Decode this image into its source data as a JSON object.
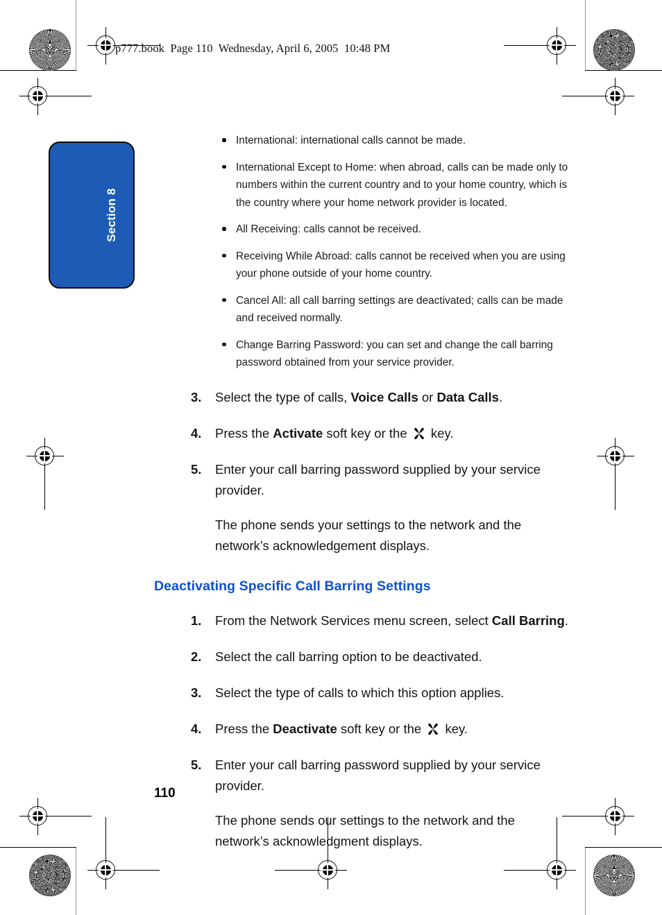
{
  "header": {
    "text": "p777.book  Page 110  Wednesday, April 6, 2005  10:48 PM"
  },
  "section_tab": {
    "label": "Section 8",
    "fill_color": "#1d5bb5",
    "border_color": "#0b0b0b",
    "text_color": "#ffffff"
  },
  "colors": {
    "heading_blue": "#0a50d6",
    "body_text": "#141414"
  },
  "bullets": [
    {
      "text": "International: international calls cannot be made."
    },
    {
      "text": "International Except to Home: when abroad, calls can be made only to numbers within the current country and to your home country, which is the country where your home network provider is located."
    },
    {
      "text": "All Receiving: calls cannot be received."
    },
    {
      "text": "Receiving While Abroad: calls cannot be received when you are using your phone outside of your home country."
    },
    {
      "text": "Cancel All: all call barring settings are deactivated; calls can be made and received normally."
    },
    {
      "text": "Change Barring Password: you can set and change the call barring password obtained from your service provider."
    }
  ],
  "steps_first": [
    {
      "num": "3.",
      "parts": [
        {
          "t": "Select the type of calls, ",
          "b": false
        },
        {
          "t": "Voice Calls",
          "b": true
        },
        {
          "t": " or ",
          "b": false
        },
        {
          "t": "Data Calls",
          "b": true
        },
        {
          "t": ".",
          "b": false
        }
      ]
    },
    {
      "num": "4.",
      "parts": [
        {
          "t": "Press the ",
          "b": false
        },
        {
          "t": "Activate",
          "b": true
        },
        {
          "t": " soft key or the ",
          "b": false
        },
        {
          "icon": "ok-key-icon"
        },
        {
          "t": " key.",
          "b": false
        }
      ]
    },
    {
      "num": "5.",
      "parts": [
        {
          "t": "Enter your call barring password supplied by your service provider.",
          "b": false
        }
      ]
    }
  ],
  "paragraph_first": "The phone sends your settings to the network and the network’s acknowledgement displays.",
  "sub_heading": "Deactivating Specific Call Barring Settings",
  "steps_second": [
    {
      "num": "1.",
      "parts": [
        {
          "t": "From the Network Services menu screen, select ",
          "b": false
        },
        {
          "t": "Call Barring",
          "b": true
        },
        {
          "t": ".",
          "b": false
        }
      ]
    },
    {
      "num": "2.",
      "parts": [
        {
          "t": "Select the call barring option to be deactivated.",
          "b": false
        }
      ]
    },
    {
      "num": "3.",
      "parts": [
        {
          "t": "Select the type of calls to which this option applies.",
          "b": false
        }
      ]
    },
    {
      "num": "4.",
      "parts": [
        {
          "t": "Press the ",
          "b": false
        },
        {
          "t": "Deactivate",
          "b": true
        },
        {
          "t": " soft key or the ",
          "b": false
        },
        {
          "icon": "ok-key-icon"
        },
        {
          "t": " key.",
          "b": false
        }
      ]
    },
    {
      "num": "5.",
      "parts": [
        {
          "t": "Enter your call barring password supplied by your service provider.",
          "b": false
        }
      ]
    }
  ],
  "paragraph_second": "The phone sends our settings to the network and the network’s acknowledgment displays.",
  "page_number": "110"
}
